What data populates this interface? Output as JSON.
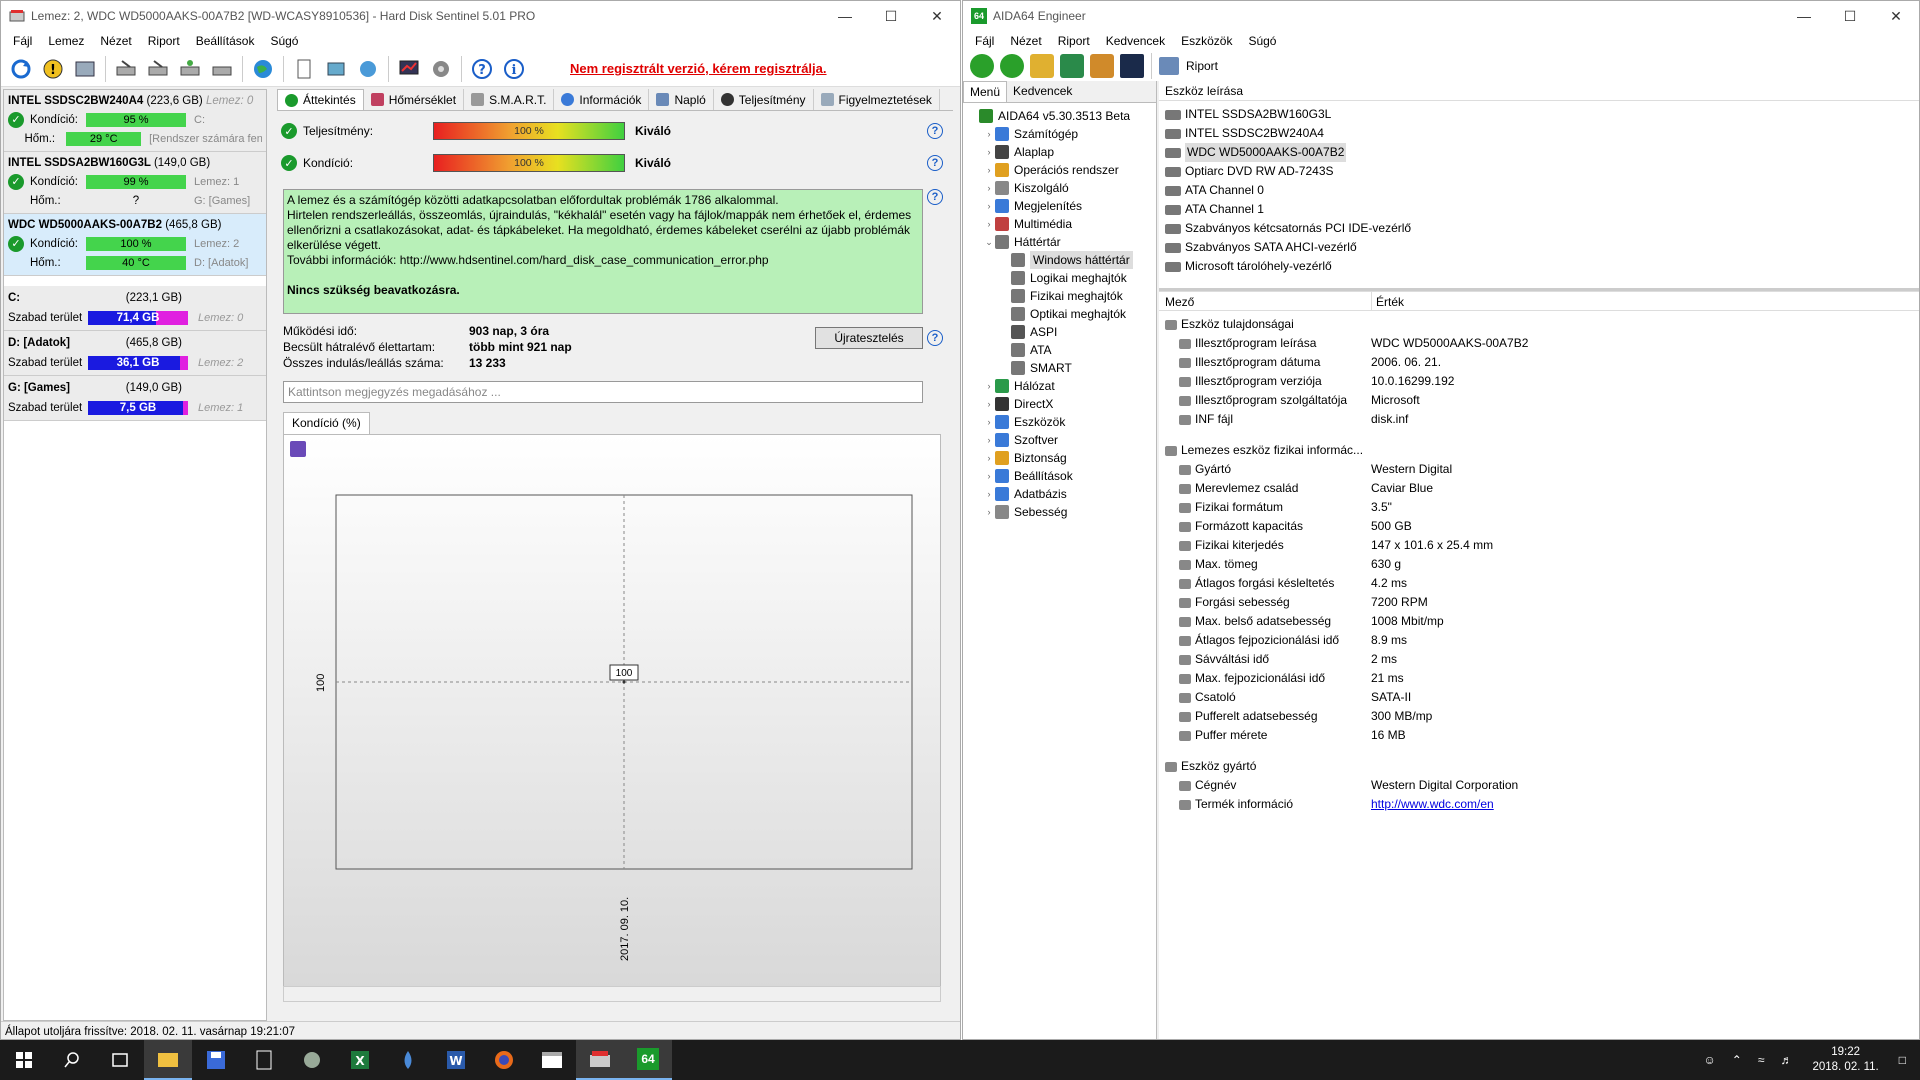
{
  "hds": {
    "title": "Lemez: 2, WDC WD5000AAKS-00A7B2 [WD-WCASY8910536] - Hard Disk Sentinel 5.01 PRO",
    "menu": [
      "Fájl",
      "Lemez",
      "Nézet",
      "Riport",
      "Beállítások",
      "Súgó"
    ],
    "unregistered": "Nem regisztrált verzió, kérem regisztrálja.",
    "disks": [
      {
        "name": "INTEL SSDSC2BW240A4",
        "size": "(223,6 GB)",
        "lemez": "Lemez: 0",
        "cond_label": "Kondíció:",
        "cond": "95 %",
        "cond_right": "C:",
        "temp_label": "Hőm.:",
        "temp": "29 °C",
        "temp_right": "[Rendszer számára fenntartott]"
      },
      {
        "name": "INTEL SSDSA2BW160G3L",
        "size": "(149,0 GB)",
        "lemez": "",
        "cond_label": "Kondíció:",
        "cond": "99 %",
        "cond_right": "Lemez: 1",
        "temp_label": "Hőm.:",
        "temp": "?",
        "temp_right": "G: [Games]"
      },
      {
        "name": "WDC WD5000AAKS-00A7B2",
        "size": "(465,8 GB)",
        "lemez": "",
        "cond_label": "Kondíció:",
        "cond": "100 %",
        "cond_right": "Lemez: 2",
        "temp_label": "Hőm.:",
        "temp": "40 °C",
        "temp_right": "D: [Adatok]"
      }
    ],
    "volumes": [
      {
        "name": "C:",
        "size": "(223,1 GB)",
        "free_label": "Szabad terület",
        "free": "71,4 GB",
        "free_pct": 32,
        "lemez": "Lemez: 0"
      },
      {
        "name": "D: [Adatok]",
        "size": "(465,8 GB)",
        "free_label": "Szabad terület",
        "free": "36,1 GB",
        "free_pct": 8,
        "lemez": "Lemez: 2"
      },
      {
        "name": "G: [Games]",
        "size": "(149,0 GB)",
        "free_label": "Szabad terület",
        "free": "7,5 GB",
        "free_pct": 5,
        "lemez": "Lemez: 1"
      }
    ],
    "tabs": [
      "Áttekintés",
      "Hőmérséklet",
      "S.M.A.R.T.",
      "Információk",
      "Napló",
      "Teljesítmény",
      "Figyelmeztetések"
    ],
    "perf_label": "Teljesítmény:",
    "perf_value": "100 %",
    "perf_text": "Kiváló",
    "cond_label": "Kondíció:",
    "cond_value": "100 %",
    "cond_text": "Kiváló",
    "message": [
      "A lemez és a számítógép közötti adatkapcsolatban előfordultak problémák 1786 alkalommal.",
      "Hirtelen rendszerleállás, összeomlás, újraindulás, \"kékhalál\" esetén vagy ha fájlok/mappák nem érhetőek el, érdemes ellenőrizni a csatlakozásokat, adat- és tápkábeleket. Ha megoldható, érdemes kábeleket cserélni az újabb problémák elkerülése végett.",
      "További információk: http://www.hdsentinel.com/hard_disk_case_communication_error.php"
    ],
    "message_bold": "Nincs szükség beavatkozásra.",
    "info": [
      {
        "k": "Működési idő:",
        "v": "903 nap, 3 óra"
      },
      {
        "k": "Becsült hátralévő élettartam:",
        "v": "több mint 921 nap"
      },
      {
        "k": "Összes indulás/leállás száma:",
        "v": "13 233"
      }
    ],
    "retest": "Újratesztelés",
    "note_placeholder": "Kattintson megjegyzés megadásához ...",
    "chart_tab": "Kondíció  (%)",
    "status": "Állapot utoljára frissítve: 2018. 02. 11. vasárnap 19:21:07"
  },
  "chart_data": {
    "type": "line",
    "x": [
      "2017. 09. 10."
    ],
    "series": [
      {
        "values": [
          100
        ]
      }
    ],
    "ylabel": "",
    "xlabel": "",
    "ytick": "100",
    "point_label": "100"
  },
  "aida": {
    "title": "AIDA64 Engineer",
    "menu": [
      "Fájl",
      "Nézet",
      "Riport",
      "Kedvencek",
      "Eszközök",
      "Súgó"
    ],
    "report": "Riport",
    "left_tabs": [
      "Menü",
      "Kedvencek"
    ],
    "tree": [
      {
        "t": "AIDA64 v5.30.3513 Beta",
        "lvl": 0,
        "ex": "",
        "c": "#2a8a2a"
      },
      {
        "t": "Számítógép",
        "lvl": 1,
        "ex": ">",
        "c": "#3a7ad8"
      },
      {
        "t": "Alaplap",
        "lvl": 1,
        "ex": ">",
        "c": "#444"
      },
      {
        "t": "Operációs rendszer",
        "lvl": 1,
        "ex": ">",
        "c": "#e0a020"
      },
      {
        "t": "Kiszolgáló",
        "lvl": 1,
        "ex": ">",
        "c": "#888"
      },
      {
        "t": "Megjelenítés",
        "lvl": 1,
        "ex": ">",
        "c": "#3a7ad8"
      },
      {
        "t": "Multimédia",
        "lvl": 1,
        "ex": ">",
        "c": "#c04040"
      },
      {
        "t": "Háttértár",
        "lvl": 1,
        "ex": "v",
        "c": "#777"
      },
      {
        "t": "Windows háttértár",
        "lvl": 2,
        "ex": "",
        "c": "#777",
        "sel": true
      },
      {
        "t": "Logikai meghajtók",
        "lvl": 2,
        "ex": "",
        "c": "#777"
      },
      {
        "t": "Fizikai meghajtók",
        "lvl": 2,
        "ex": "",
        "c": "#777"
      },
      {
        "t": "Optikai meghajtók",
        "lvl": 2,
        "ex": "",
        "c": "#777"
      },
      {
        "t": "ASPI",
        "lvl": 2,
        "ex": "",
        "c": "#555"
      },
      {
        "t": "ATA",
        "lvl": 2,
        "ex": "",
        "c": "#777"
      },
      {
        "t": "SMART",
        "lvl": 2,
        "ex": "",
        "c": "#777"
      },
      {
        "t": "Hálózat",
        "lvl": 1,
        "ex": ">",
        "c": "#2a9a4a"
      },
      {
        "t": "DirectX",
        "lvl": 1,
        "ex": ">",
        "c": "#333"
      },
      {
        "t": "Eszközök",
        "lvl": 1,
        "ex": ">",
        "c": "#3a7ad8"
      },
      {
        "t": "Szoftver",
        "lvl": 1,
        "ex": ">",
        "c": "#3a7ad8"
      },
      {
        "t": "Biztonság",
        "lvl": 1,
        "ex": ">",
        "c": "#e0a020"
      },
      {
        "t": "Beállítások",
        "lvl": 1,
        "ex": ">",
        "c": "#3a7ad8"
      },
      {
        "t": "Adatbázis",
        "lvl": 1,
        "ex": ">",
        "c": "#3a7ad8"
      },
      {
        "t": "Sebesség",
        "lvl": 1,
        "ex": ">",
        "c": "#888"
      }
    ],
    "device_header": "Eszköz leírása",
    "devices": [
      {
        "t": "INTEL SSDSA2BW160G3L"
      },
      {
        "t": "INTEL SSDSC2BW240A4"
      },
      {
        "t": "WDC WD5000AAKS-00A7B2",
        "sel": true
      },
      {
        "t": "Optiarc DVD RW AD-7243S"
      },
      {
        "t": "ATA Channel 0"
      },
      {
        "t": "ATA Channel 1"
      },
      {
        "t": "Szabványos kétcsatornás PCI IDE-vezérlő"
      },
      {
        "t": "Szabványos SATA AHCI-vezérlő"
      },
      {
        "t": "Microsoft tárolóhely-vezérlő"
      }
    ],
    "col_field": "Mező",
    "col_value": "Érték",
    "groups": [
      {
        "name": "Eszköz tulajdonságai",
        "rows": [
          {
            "k": "Illesztőprogram leírása",
            "v": "WDC WD5000AAKS-00A7B2"
          },
          {
            "k": "Illesztőprogram dátuma",
            "v": "2006. 06. 21."
          },
          {
            "k": "Illesztőprogram verziója",
            "v": "10.0.16299.192"
          },
          {
            "k": "Illesztőprogram szolgáltatója",
            "v": "Microsoft"
          },
          {
            "k": "INF fájl",
            "v": "disk.inf"
          }
        ]
      },
      {
        "name": "Lemezes eszköz fizikai informác...",
        "rows": [
          {
            "k": "Gyártó",
            "v": "Western Digital"
          },
          {
            "k": "Merevlemez család",
            "v": "Caviar Blue"
          },
          {
            "k": "Fizikai formátum",
            "v": "3.5\""
          },
          {
            "k": "Formázott kapacitás",
            "v": "500 GB"
          },
          {
            "k": "Fizikai kiterjedés",
            "v": "147 x 101.6 x 25.4 mm"
          },
          {
            "k": "Max. tömeg",
            "v": "630 g"
          },
          {
            "k": "Átlagos forgási késleltetés",
            "v": "4.2 ms"
          },
          {
            "k": "Forgási sebesség",
            "v": "7200 RPM"
          },
          {
            "k": "Max. belső adatsebesség",
            "v": "1008 Mbit/mp"
          },
          {
            "k": "Átlagos fejpozicionálási idő",
            "v": "8.9 ms"
          },
          {
            "k": "Sávváltási idő",
            "v": "2 ms"
          },
          {
            "k": "Max. fejpozicionálási idő",
            "v": "21 ms"
          },
          {
            "k": "Csatoló",
            "v": "SATA-II"
          },
          {
            "k": "Pufferelt adatsebesség",
            "v": "300 MB/mp"
          },
          {
            "k": "Puffer mérete",
            "v": "16 MB"
          }
        ]
      },
      {
        "name": "Eszköz gyártó",
        "rows": [
          {
            "k": "Cégnév",
            "v": "Western Digital Corporation"
          },
          {
            "k": "Termék információ",
            "v": "http://www.wdc.com/en",
            "link": true
          }
        ]
      }
    ]
  },
  "taskbar": {
    "time": "19:22",
    "date": "2018. 02. 11."
  }
}
